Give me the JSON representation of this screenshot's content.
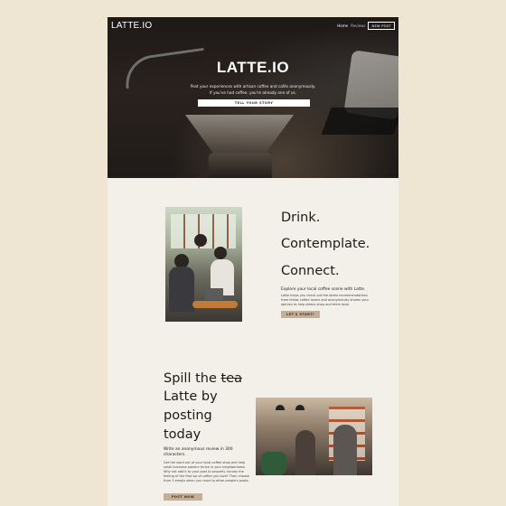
{
  "header": {
    "brand": "LATTE.IO",
    "nav": {
      "home": "Home",
      "reviews": "Reviews",
      "new_post": "NEW POST"
    }
  },
  "hero": {
    "title": "LATTE.IO",
    "subtitle_line1": "Post your experiences with artisan coffee and cafés anonymously.",
    "subtitle_line2": "If you've had coffee, you're already one of us.",
    "cta": "TELL YOUR STORY"
  },
  "intro": {
    "lines": [
      "Drink.",
      "Contemplate.",
      "Connect."
    ],
    "tagline": "Explore your local coffee scene with Latte.",
    "body": "Latte helps you check out the latest recommendations from fellow coffee lovers and anonymously shares your opinion to help others shop and drink local.",
    "cta": "LET'S START!"
  },
  "post_section": {
    "title_word1": "Spill the",
    "title_struck": "tea",
    "title_line2": "Latte by",
    "title_line3": "posting",
    "title_line4": "today",
    "lead": "Write an anonymous review in 300 characters.",
    "body": "Get the word out of your local coffee shop and help small business owners thrive in your neighborhood. Why not add it to your post to properly convey the feeling of the first sip of coffee you love? Then choose from 3 emojis when you react to other people's posts.",
    "cta": "POST NOW"
  },
  "colors": {
    "page_background": "#efe5d3",
    "content_background": "#f3f0e9",
    "button_tan": "#c4ae96",
    "hero_dark": "#2a2320"
  }
}
